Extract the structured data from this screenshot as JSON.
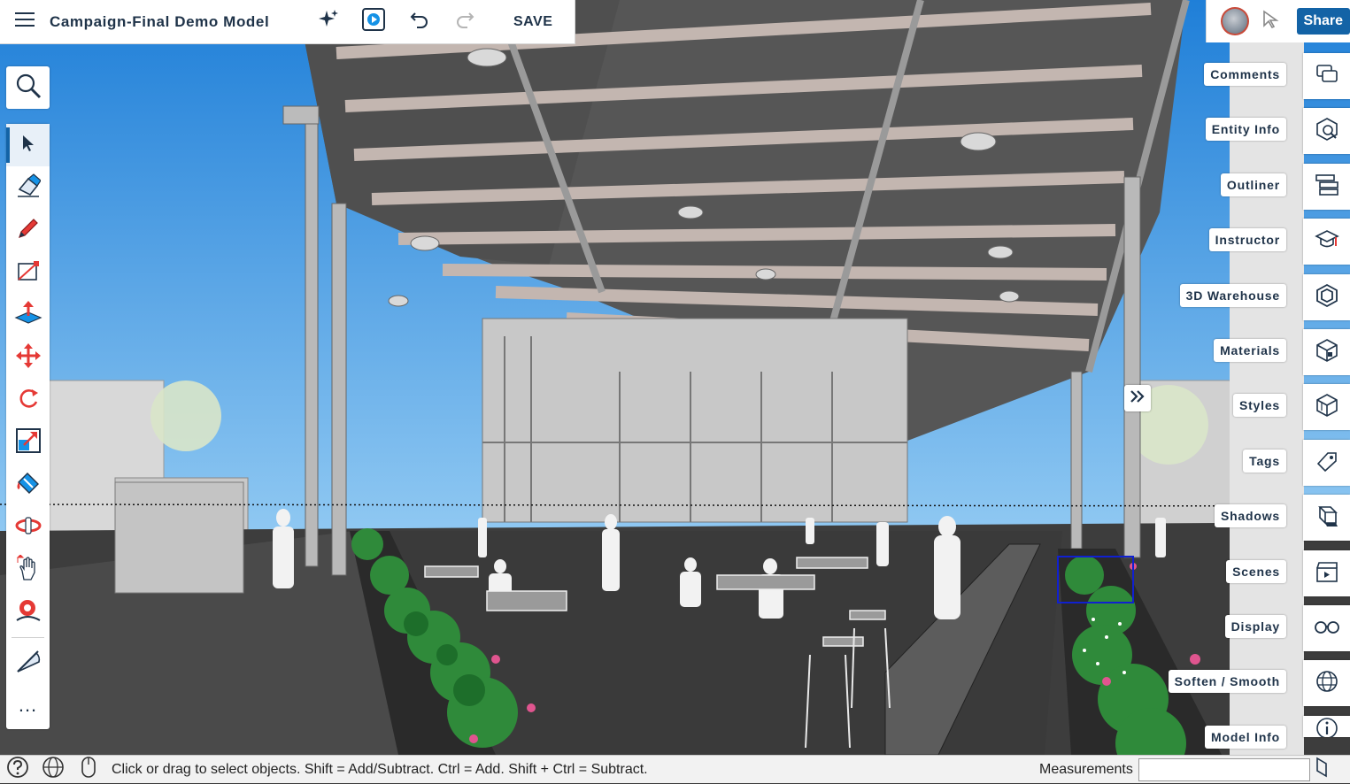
{
  "app": {
    "title": "Campaign-Final Demo Model",
    "save_label": "SAVE",
    "share_label": "Share"
  },
  "left_toolbar": {
    "search": "search-icon",
    "tools": [
      {
        "name": "select-tool",
        "icon": "arrow-cursor-icon",
        "active": true
      },
      {
        "name": "eraser-tool",
        "icon": "eraser-icon"
      },
      {
        "name": "pencil-tool",
        "icon": "pencil-icon"
      },
      {
        "name": "rectangle-tool",
        "icon": "rectangle-icon"
      },
      {
        "name": "push-pull-tool",
        "icon": "push-pull-icon"
      },
      {
        "name": "move-tool",
        "icon": "move-arrows-icon"
      },
      {
        "name": "rotate-tool",
        "icon": "rotate-icon"
      },
      {
        "name": "scale-tool",
        "icon": "scale-icon"
      },
      {
        "name": "paint-bucket-tool",
        "icon": "paint-bucket-icon"
      },
      {
        "name": "orbit-tool",
        "icon": "orbit-icon"
      },
      {
        "name": "pan-tool",
        "icon": "hand-icon"
      },
      {
        "name": "position-camera-tool",
        "icon": "camera-position-icon"
      }
    ],
    "extra": [
      {
        "name": "tape-measure-tool",
        "icon": "protractor-icon"
      },
      {
        "name": "more-tools",
        "icon": "more-icon",
        "label": "..."
      }
    ]
  },
  "right_panels": [
    {
      "label": "Comments",
      "icon": "comments-icon"
    },
    {
      "label": "Entity Info",
      "icon": "entity-info-icon"
    },
    {
      "label": "Outliner",
      "icon": "outliner-icon"
    },
    {
      "label": "Instructor",
      "icon": "graduation-cap-icon"
    },
    {
      "label": "3D Warehouse",
      "icon": "warehouse-icon"
    },
    {
      "label": "Materials",
      "icon": "materials-cube-icon"
    },
    {
      "label": "Styles",
      "icon": "styles-box-icon"
    },
    {
      "label": "Tags",
      "icon": "tag-icon"
    },
    {
      "label": "Shadows",
      "icon": "shadow-box-icon"
    },
    {
      "label": "Scenes",
      "icon": "clapperboard-icon"
    },
    {
      "label": "Display",
      "icon": "glasses-icon"
    },
    {
      "label": "Soften / Smooth",
      "icon": "globe-mesh-icon"
    },
    {
      "label": "Model Info",
      "icon": "info-icon"
    }
  ],
  "status": {
    "hint": "Click or drag to select objects. Shift = Add/Subtract. Ctrl = Add. Shift + Ctrl = Subtract.",
    "measurements_label": "Measurements",
    "measurements_value": ""
  },
  "colors": {
    "accent": "#1363a6",
    "text_dark": "#1f3349",
    "sky": "#2f8fe0",
    "ground": "#3d3d3d",
    "roof_beam": "#bfb3ad",
    "foliage": "#2e8b3a",
    "flower": "#e0558f"
  }
}
